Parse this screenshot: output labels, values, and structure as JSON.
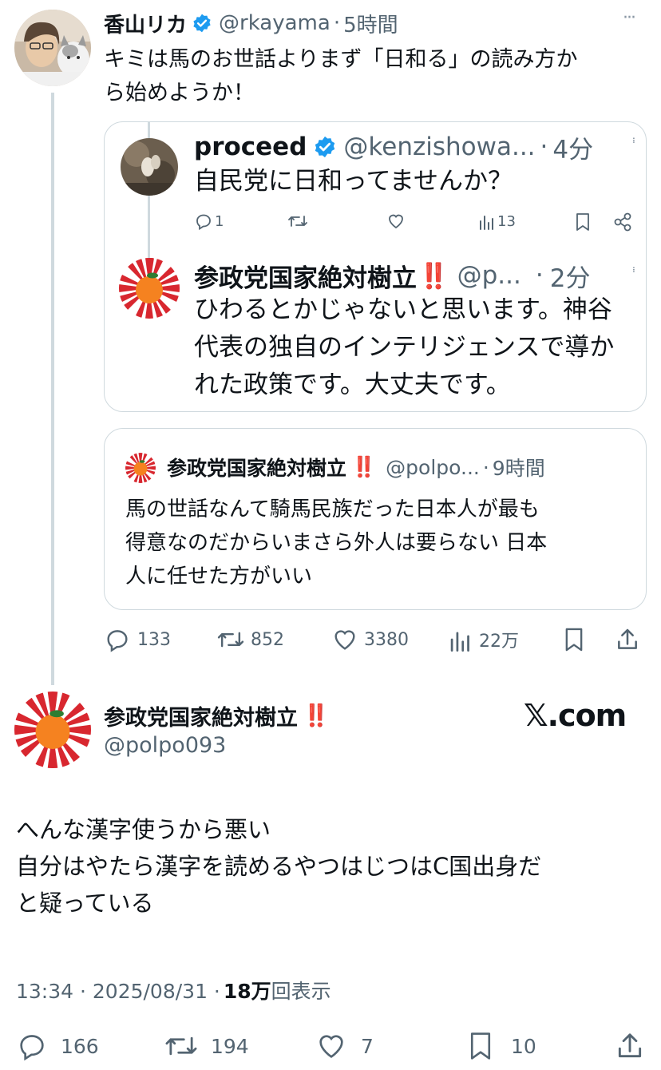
{
  "main_tweet": {
    "author": "香山リカ",
    "handle": "@rkayama",
    "time": "5時間",
    "text_lines": [
      "キミは馬のお世話よりまず「日和る」の読み方か",
      "ら始めようか！"
    ]
  },
  "quoted_thread": {
    "first": {
      "author": "proceed",
      "handle": "@kenzishowa...",
      "time": "4分",
      "text": "自民党に日和ってませんか？",
      "reply_count": "1",
      "view_count": "13"
    },
    "reply": {
      "author": "参政党国家絶対樹立",
      "emoji": "‼️",
      "handle": "@p...",
      "time": "2分",
      "text_lines": [
        "ひわるとかじゃないと思います。神谷",
        "代表の独自のインテリジェンスで導か",
        "れた政策です。大丈夫です。"
      ]
    }
  },
  "quoted_tweet": {
    "author": "参政党国家絶対樹立",
    "emoji": "‼️",
    "handle": "@polpo...",
    "time": "9時間",
    "text_lines": [
      "馬の世話なんて騎馬民族だった日本人が最も",
      "得意なのだからいまさら外人は要らない 日本",
      "人に任せた方がいい"
    ]
  },
  "main_actions": {
    "replies": "133",
    "retweets": "852",
    "likes": "3380",
    "views": "22万"
  },
  "focus_tweet": {
    "author": "参政党国家絶対樹立",
    "emoji": "‼️",
    "handle": "@polpo093",
    "watermark": "𝕏.com",
    "text_lines": [
      "へんな漢字使うから悪い",
      "自分はやたら漢字を読めるやつはじつはC国出身だ",
      "と疑っている"
    ],
    "timestamp": "13:34 · 2025/08/31 · ",
    "views_count": "18万",
    "views_label": "回表示",
    "replies": "166",
    "retweets": "194",
    "likes": "7",
    "bookmarks": "10"
  },
  "colors": {
    "text": "#0f1419",
    "muted": "#536471",
    "border": "#cfd9de",
    "verified": "#1d9bf0",
    "red": "#e0245e"
  }
}
